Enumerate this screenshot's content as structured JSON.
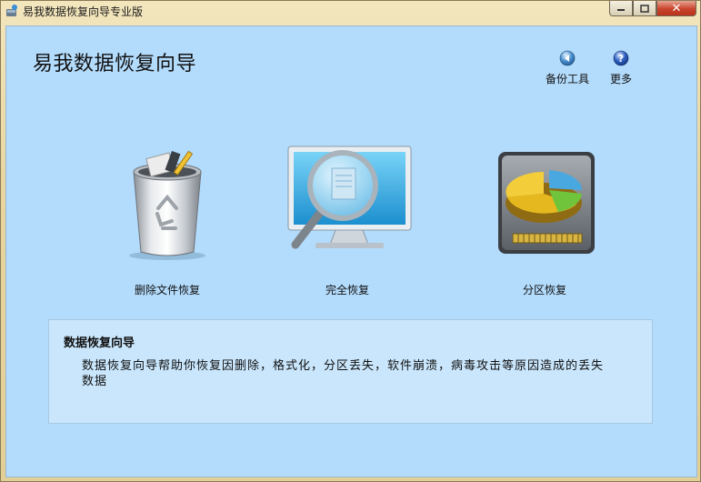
{
  "window": {
    "title": "易我数据恢复向导专业版",
    "buttons": {
      "minimize": "▭",
      "maximize": "▢",
      "close": "✕"
    }
  },
  "header": {
    "title": "易我数据恢复向导",
    "tools": [
      {
        "label": "备份工具",
        "icon": "backup-arrow-icon"
      },
      {
        "label": "更多",
        "icon": "help-question-icon"
      }
    ]
  },
  "options": [
    {
      "label": "删除文件恢复",
      "icon": "recycle-bin-icon"
    },
    {
      "label": "完全恢复",
      "icon": "monitor-magnifier-icon"
    },
    {
      "label": "分区恢复",
      "icon": "hard-drive-pie-icon"
    }
  ],
  "info": {
    "title": "数据恢复向导",
    "text": "数据恢复向导帮助你恢复因删除，格式化，分区丢失，软件崩溃，病毒攻击等原因造成的丢失数据"
  },
  "colors": {
    "client_bg": "#b3dbfb",
    "infobox_bg": "#c9e6fc",
    "frame": "#e8d59f",
    "close_button": "#c9442d"
  }
}
